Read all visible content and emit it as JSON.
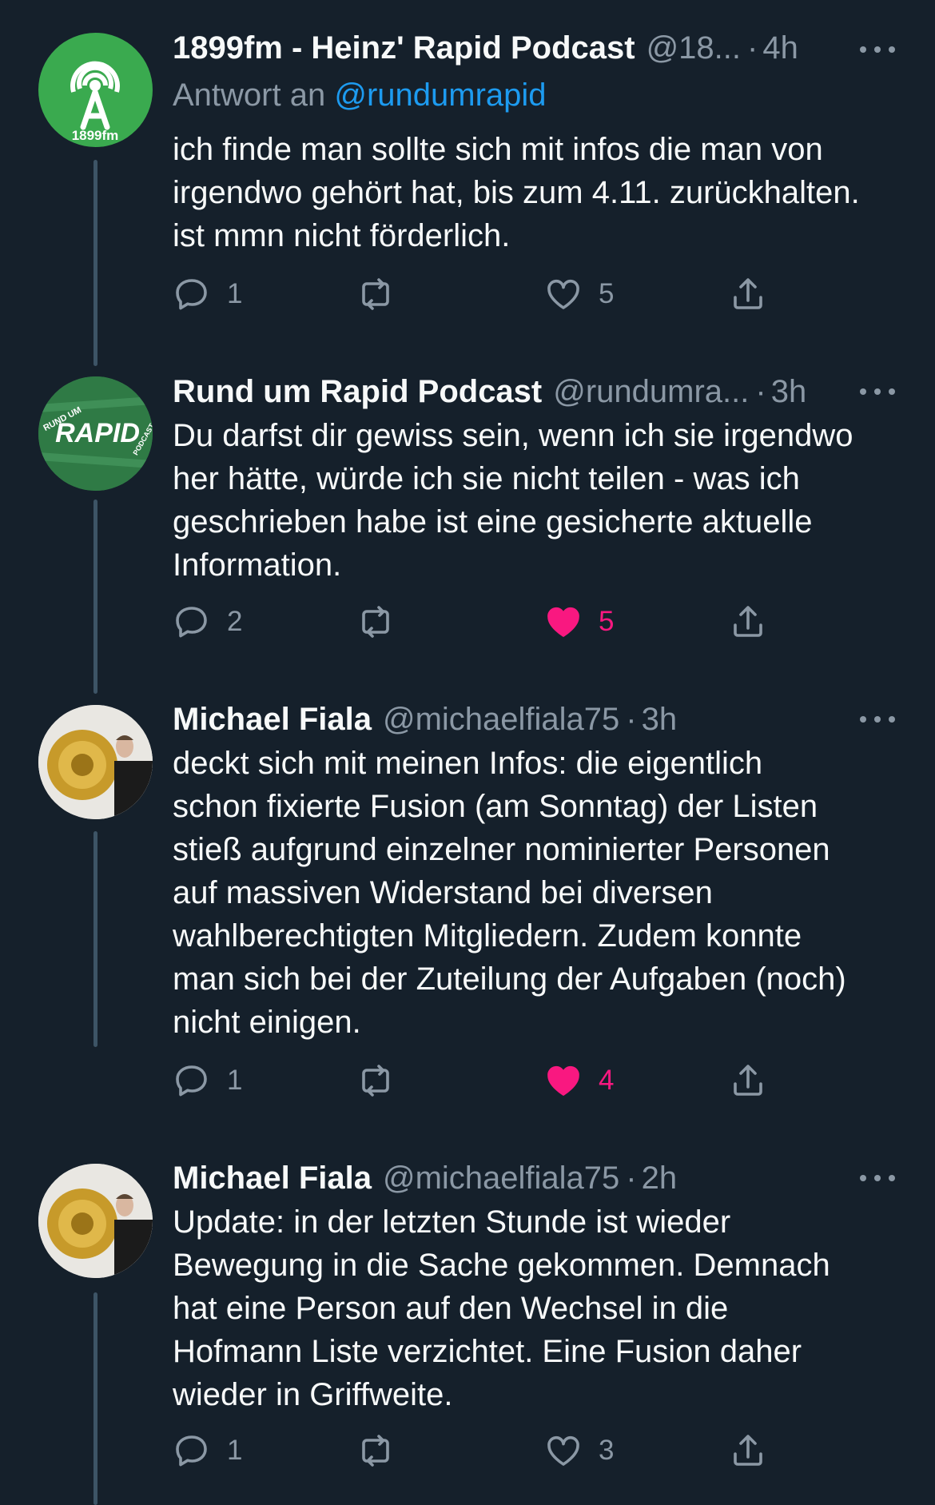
{
  "tweets": [
    {
      "name": "1899fm - Heinz' Rapid Podcast",
      "handle": "@18...",
      "time": "4h",
      "reply_to_label": "Antwort an",
      "reply_to_handle": "@rundumrapid",
      "text": "ich finde man sollte sich mit infos die man von\nirgendwo gehört hat, bis zum 4.11. zurückhalten.\nist mmn nicht förderlich.",
      "avatar_text": "1899fm",
      "avatar_color": "#3aaa4f",
      "replies": "1",
      "retweets": "",
      "likes": "5",
      "liked": false
    },
    {
      "name": "Rund um Rapid Podcast",
      "handle": "@rundumra...",
      "time": "3h",
      "text": "Du darfst dir gewiss sein, wenn ich sie irgendwo\nher hätte, würde ich sie nicht teilen - was ich\ngeschrieben habe ist eine gesicherte aktuelle\nInformation.",
      "avatar_text": "RAPID",
      "avatar_top_text": "RUND UM",
      "avatar_bottom_text": "PODCAST",
      "avatar_color": "#2f7a45",
      "replies": "2",
      "retweets": "",
      "likes": "5",
      "liked": true
    },
    {
      "name": "Michael Fiala",
      "handle": "@michaelfiala75",
      "time": "3h",
      "text": "deckt sich mit meinen Infos: die eigentlich\nschon fixierte Fusion (am Sonntag) der  Listen\nstieß aufgrund einzelner nominierter Personen\nauf massiven Widerstand bei diversen\nwahlberechtigten Mitgliedern. Zudem konnte\nman sich bei der Zuteilung der Aufgaben (noch)\nnicht einigen.",
      "replies": "1",
      "retweets": "",
      "likes": "4",
      "liked": true
    },
    {
      "name": "Michael Fiala",
      "handle": "@michaelfiala75",
      "time": "2h",
      "text": "Update: in der letzten Stunde ist wieder\nBewegung in die Sache gekommen. Demnach\nhat eine Person auf den Wechsel in die\nHofmann Liste verzichtet. Eine Fusion daher\nwieder in Griffweite.",
      "replies": "1",
      "retweets": "",
      "likes": "3",
      "liked": false
    }
  ],
  "colors": {
    "background": "#15202b",
    "secondary_text": "#8b98a5",
    "link": "#1d9bf0",
    "like": "#f91880",
    "thread_line": "#3d5466"
  },
  "icons": [
    "reply-icon",
    "retweet-icon",
    "like-icon",
    "share-icon",
    "more-icon"
  ]
}
